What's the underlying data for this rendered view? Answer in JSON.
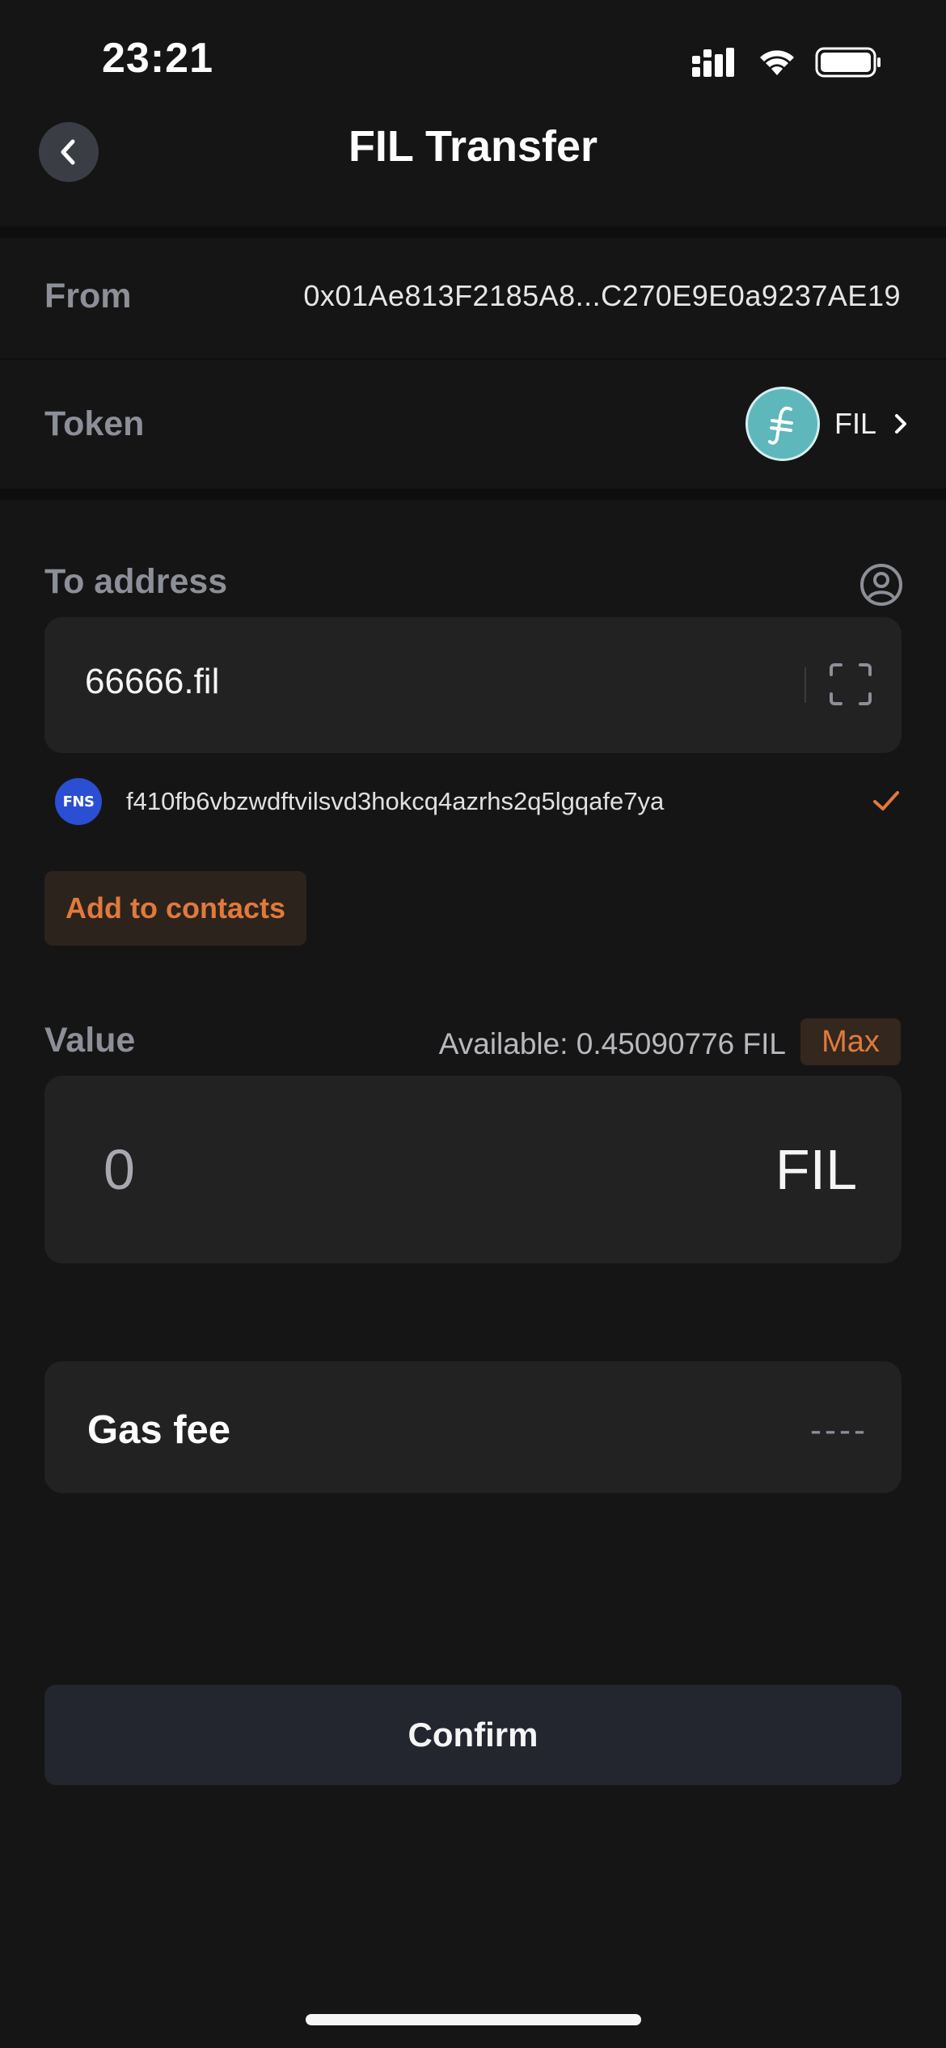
{
  "status_bar": {
    "time": "23:21"
  },
  "header": {
    "title": "FIL Transfer"
  },
  "from": {
    "label": "From",
    "value": "0x01Ae813F2185A8...C270E9E0a9237AE19"
  },
  "token": {
    "label": "Token",
    "name": "FIL"
  },
  "to_address": {
    "label": "To address",
    "value": "66666.fil",
    "resolved_address": "f410fb6vbzwdftvilsvd3hokcq4azrhs2q5lgqafe7ya",
    "resolver_logo_text": "FNS",
    "add_contacts_label": "Add to contacts"
  },
  "value": {
    "label": "Value",
    "available": "Available: 0.45090776 FIL",
    "max_label": "Max",
    "amount": "0",
    "unit": "FIL"
  },
  "gas_fee": {
    "label": "Gas fee",
    "value": "----"
  },
  "confirm": {
    "label": "Confirm"
  },
  "colors": {
    "background": "#151515",
    "card": "#222223",
    "accent": "#e07a3c",
    "muted_label": "#8d8f98",
    "token_logo": "#5eb7bb",
    "fns_logo": "#2b4fd2"
  }
}
